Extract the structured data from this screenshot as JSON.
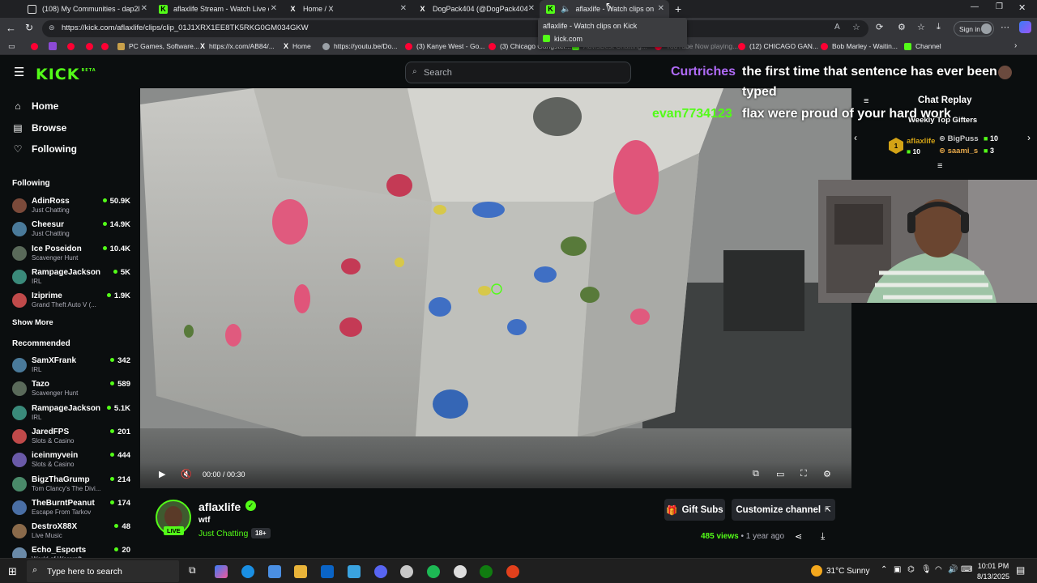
{
  "browser": {
    "tabs": [
      {
        "title": "(108) My Communities - dap2k C",
        "icon": "community-icon"
      },
      {
        "title": "aflaxlife Stream - Watch Live on K",
        "icon": "kick-icon"
      },
      {
        "title": "Home / X",
        "icon": "x-icon"
      },
      {
        "title": "DogPack404 (@DogPack404) / X",
        "icon": "x-icon"
      },
      {
        "title": "aflaxlife - Watch clips on Kick",
        "icon": "kick-icon",
        "active": true
      }
    ],
    "url": "https://kick.com/aflaxlife/clips/clip_01J1XRX1EE8TK5RKG0GM034GKW",
    "sign_in_label": "Sign in",
    "tooltip": {
      "title": "aflaxlife - Watch clips on Kick",
      "domain": "kick.com"
    },
    "bookmarks": [
      "PC Games, Software...",
      "https://x.com/AB84/...",
      "Home",
      "https://youtu.be/Do...",
      "(3) Kanye West - Go...",
      "(3) Chicago Gangster...",
      "AdvisBest Chatting...",
      "YouTube Now playing...",
      "(12) CHICAGO GAN...",
      "Bob Marley - Waitin...",
      "Channel"
    ]
  },
  "kick": {
    "logo": "KICK",
    "logo_badge": "BETA",
    "search_placeholder": "Search",
    "nav": [
      {
        "label": "Home",
        "icon": "home-icon"
      },
      {
        "label": "Browse",
        "icon": "browse-icon"
      },
      {
        "label": "Following",
        "icon": "heart-icon"
      }
    ],
    "following_heading": "Following",
    "following": [
      {
        "name": "AdinRoss",
        "category": "Just Chatting",
        "viewers": "50.9K"
      },
      {
        "name": "Cheesur",
        "category": "Just Chatting",
        "viewers": "14.9K"
      },
      {
        "name": "Ice Poseidon",
        "category": "Scavenger Hunt",
        "viewers": "10.4K"
      },
      {
        "name": "RampageJackson",
        "category": "IRL",
        "viewers": "5K"
      },
      {
        "name": "Iziprime",
        "category": "Grand Theft Auto V (...",
        "viewers": "1.9K"
      }
    ],
    "show_more": "Show More",
    "recommended_heading": "Recommended",
    "recommended": [
      {
        "name": "SamXFrank",
        "category": "IRL",
        "viewers": "342"
      },
      {
        "name": "Tazo",
        "category": "Scavenger Hunt",
        "viewers": "589"
      },
      {
        "name": "RampageJackson",
        "category": "IRL",
        "viewers": "5.1K"
      },
      {
        "name": "JaredFPS",
        "category": "Slots & Casino",
        "viewers": "201"
      },
      {
        "name": "iceinmyvein",
        "category": "Slots & Casino",
        "viewers": "444"
      },
      {
        "name": "BigzThaGrump",
        "category": "Tom Clancy's The Divi...",
        "viewers": "214"
      },
      {
        "name": "TheBurntPeanut",
        "category": "Escape From Tarkov",
        "viewers": "174"
      },
      {
        "name": "DestroX88X",
        "category": "Live Music",
        "viewers": "48"
      },
      {
        "name": "Echo_Esports",
        "category": "World of Warcraft",
        "viewers": "20"
      }
    ],
    "player": {
      "time": "00:00 / 00:30"
    },
    "chat_overlay": [
      {
        "user": "Curtriches",
        "color": "#b06bf7",
        "text": "the first time that sentence has ever been",
        "cont": "typed"
      },
      {
        "user": "evan7734123",
        "color": "#53fc18",
        "text": "flax were proud of your hard work"
      }
    ],
    "chat_replay": {
      "title": "Chat Replay",
      "gifters_title": "Weekly Top Gifters",
      "gifters": [
        {
          "rank": "1",
          "name": "aflaxlife",
          "count": "10"
        },
        {
          "name": "BigPuss",
          "count": "10"
        },
        {
          "name": "saami_s",
          "count": "3"
        }
      ]
    },
    "channel": {
      "name": "aflaxlife",
      "live_badge": "LIVE",
      "clip_title": "wtf",
      "category": "Just Chatting",
      "age_badge": "18+",
      "gift_subs": "Gift Subs",
      "customize": "Customize channel",
      "views": "485",
      "views_label": "views",
      "age": "• 1 year ago"
    }
  },
  "taskbar": {
    "search_placeholder": "Type here to search",
    "weather": "31°C  Sunny",
    "time": "10:01 PM",
    "date": "8/13/2025"
  }
}
